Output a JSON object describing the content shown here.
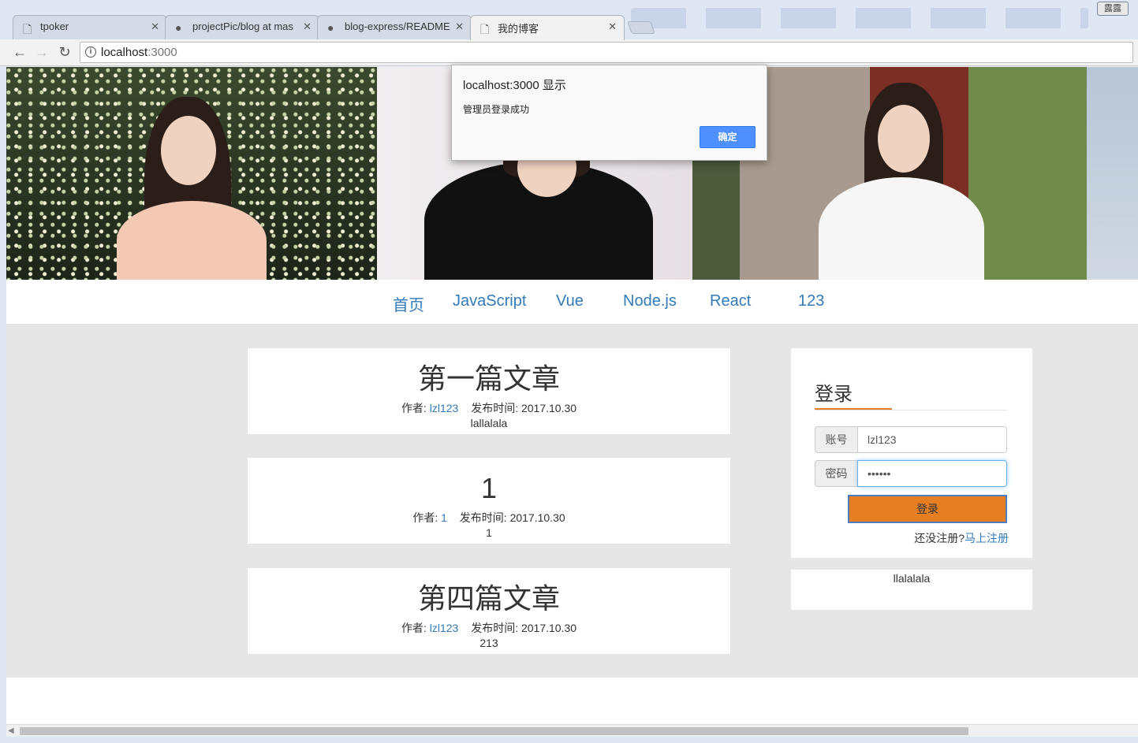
{
  "browser": {
    "tabs": [
      {
        "title": "tpoker",
        "icon": "page-icon"
      },
      {
        "title": "projectPic/blog at mas",
        "icon": "github-icon"
      },
      {
        "title": "blog-express/README",
        "icon": "github-icon"
      },
      {
        "title": "我的博客",
        "icon": "page-icon",
        "active": true
      }
    ],
    "url_host": "localhost",
    "url_port": ":3000",
    "window_button": "露露"
  },
  "nav": {
    "items": [
      "首页",
      "JavaScript",
      "Vue",
      "Node.js",
      "React",
      "123"
    ],
    "link_color": "#337ab7"
  },
  "posts": [
    {
      "title": "第一篇文章",
      "author_label": "作者:",
      "author": "lzl123",
      "date_label": "发布时间:",
      "date": "2017.10.30",
      "body": "lallalala"
    },
    {
      "title": "1",
      "author_label": "作者:",
      "author": "1",
      "date_label": "发布时间:",
      "date": "2017.10.30",
      "body": "1"
    },
    {
      "title": "第四篇文章",
      "author_label": "作者:",
      "author": "lzl123",
      "date_label": "发布时间:",
      "date": "2017.10.30",
      "body": "213"
    }
  ],
  "login": {
    "title": "登录",
    "account_label": "账号",
    "account_value": "lzl123",
    "password_label": "密码",
    "password_value": "••••••",
    "submit_label": "登录",
    "register_prompt": "还没注册?",
    "register_link": "马上注册",
    "accent_color": "#e67e22"
  },
  "side_box": {
    "text": "llalalala"
  },
  "dialog": {
    "title": "localhost:3000 显示",
    "message": "管理员登录成功",
    "ok_label": "确定"
  }
}
